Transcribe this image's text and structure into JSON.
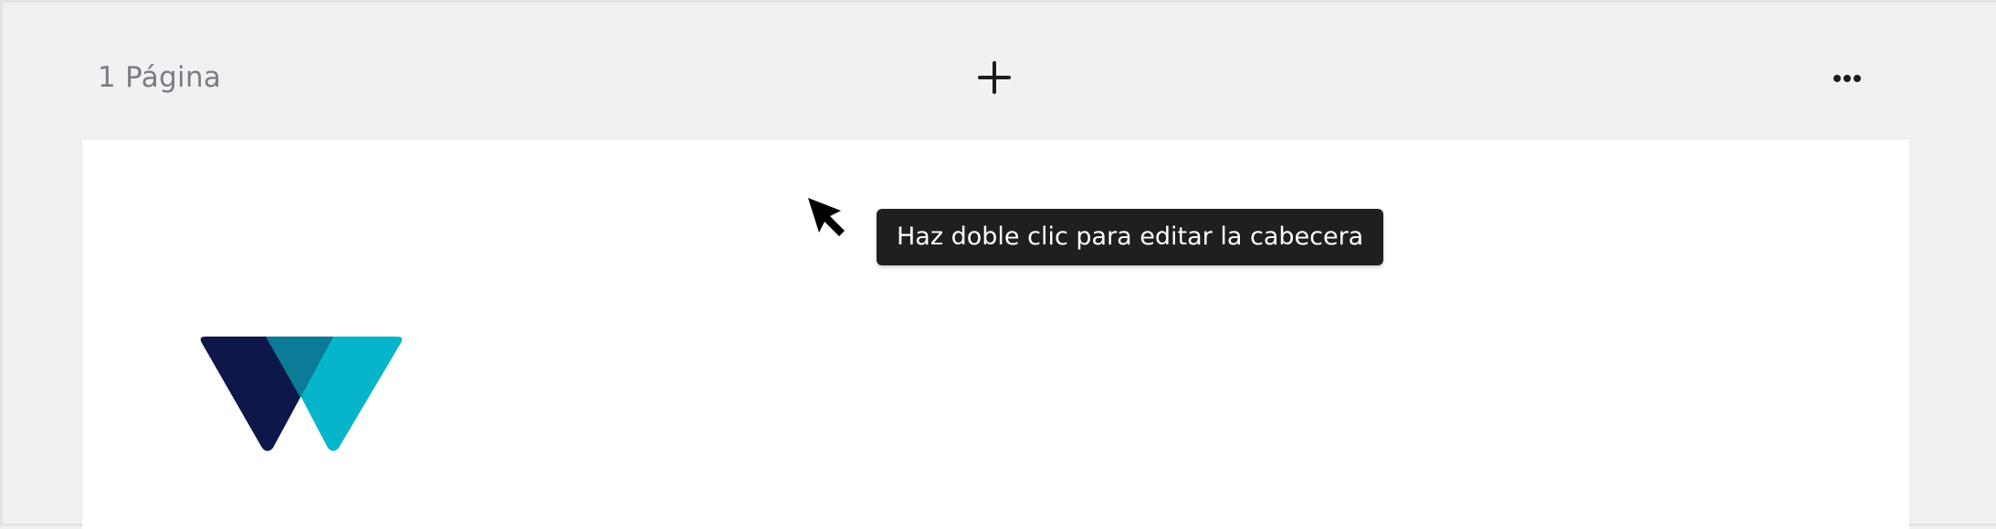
{
  "toolbar": {
    "page_count_label": "1 Página",
    "add_icon": "plus-icon",
    "more_icon": "more-horizontal-icon"
  },
  "page": {
    "logo_icon": "w-logo",
    "logo_colors": {
      "navy": "#0e174a",
      "teal_dark": "#0c7b98",
      "cyan": "#06b5c9"
    }
  },
  "tooltip": {
    "text": "Haz doble clic para editar la cabecera"
  },
  "cursor": {
    "icon": "arrow-cursor-icon"
  },
  "colors": {
    "background": "#f0f1f3",
    "page": "#ffffff",
    "tooltip_bg": "#1f1f21",
    "muted_text": "#7a7d84"
  }
}
